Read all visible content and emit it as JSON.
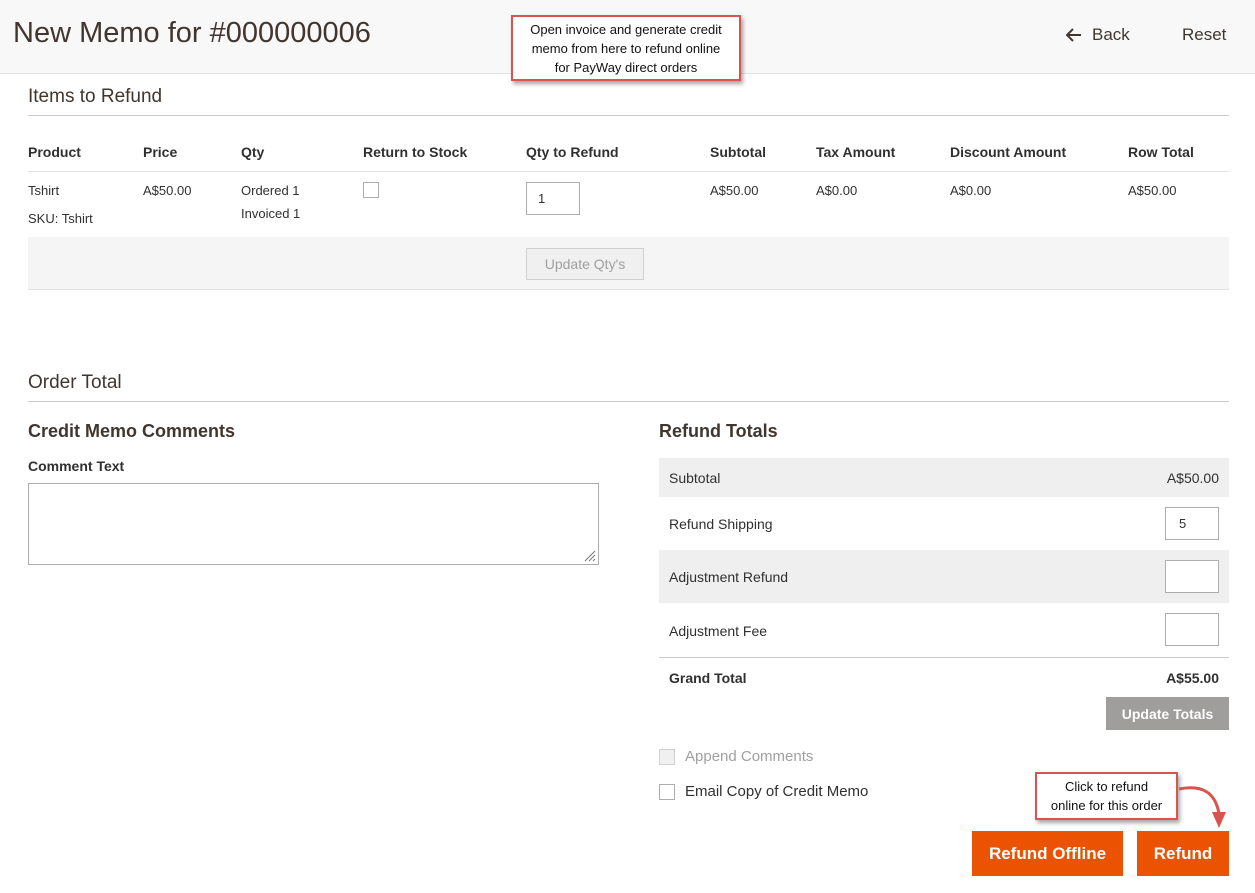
{
  "header": {
    "title": "New Memo for #000000006",
    "back_label": "Back",
    "reset_label": "Reset"
  },
  "callouts": {
    "top": [
      "Open invoice and generate credit",
      "memo from here to refund online",
      "for PayWay direct orders"
    ],
    "refund": [
      "Click to refund",
      "online for this order"
    ]
  },
  "items_section": {
    "title": "Items to Refund",
    "columns": [
      "Product",
      "Price",
      "Qty",
      "Return to Stock",
      "Qty to Refund",
      "Subtotal",
      "Tax Amount",
      "Discount Amount",
      "Row Total"
    ],
    "row": {
      "product": "Tshirt",
      "sku": "SKU: Tshirt",
      "price": "A$50.00",
      "qty_ordered": "Ordered 1",
      "qty_invoiced": "Invoiced 1",
      "qty_to_refund": "1",
      "subtotal": "A$50.00",
      "tax_amount": "A$0.00",
      "discount_amount": "A$0.00",
      "row_total": "A$50.00"
    },
    "update_qty_label": "Update Qty's"
  },
  "order_total": {
    "title": "Order Total",
    "comments": {
      "title": "Credit Memo Comments",
      "label": "Comment Text",
      "value": ""
    },
    "refund_totals": {
      "title": "Refund Totals",
      "subtotal_label": "Subtotal",
      "subtotal_value": "A$50.00",
      "shipping_label": "Refund Shipping",
      "shipping_value": "5",
      "adjustment_refund_label": "Adjustment Refund",
      "adjustment_refund_value": "",
      "adjustment_fee_label": "Adjustment Fee",
      "adjustment_fee_value": "",
      "grand_total_label": "Grand Total",
      "grand_total_value": "A$55.00",
      "update_totals_label": "Update Totals"
    },
    "options": {
      "append_comments": "Append Comments",
      "email_copy": "Email Copy of Credit Memo"
    },
    "buttons": {
      "refund_offline": "Refund Offline",
      "refund": "Refund"
    }
  },
  "colors": {
    "primary": "#eb5202",
    "callout_border": "#d9534f",
    "disabled_button": "#a09e9b"
  }
}
